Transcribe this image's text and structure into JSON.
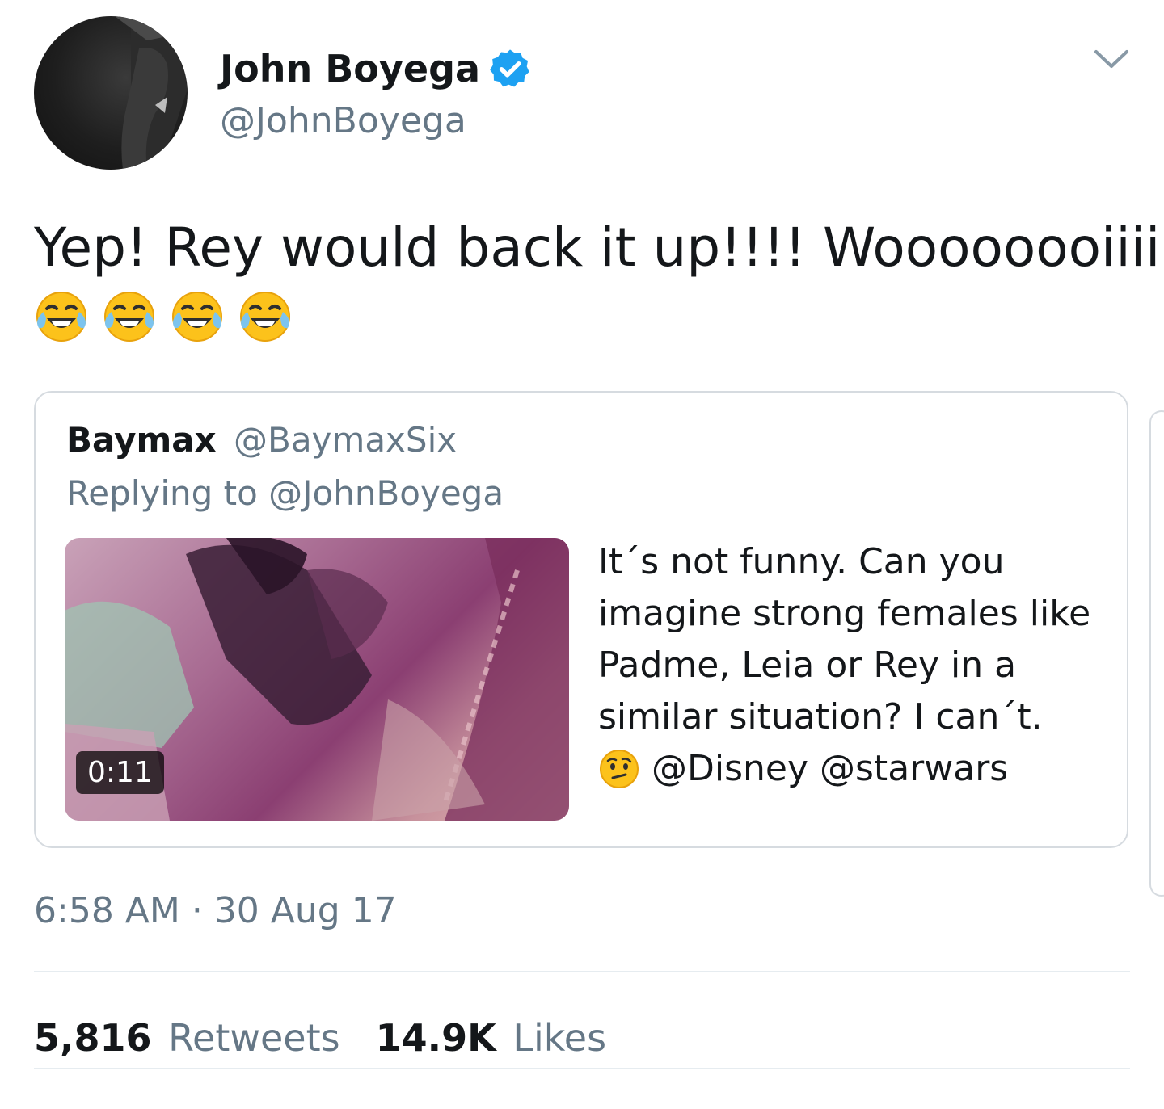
{
  "author": {
    "name": "John Boyega",
    "handle": "@JohnBoyega",
    "verified_icon": "verified-badge-icon",
    "menu_icon": "chevron-down-icon"
  },
  "tweet": {
    "text": "Yep! Rey would back it up!!!! Woooooooiiiiiii",
    "emoji": [
      "face-with-tears-of-joy",
      "face-with-tears-of-joy",
      "face-with-tears-of-joy",
      "face-with-tears-of-joy"
    ]
  },
  "quoted_tweet": {
    "name": "Baymax",
    "handle": "@BaymaxSix",
    "replying_prefix": "Replying to",
    "replying_to": "@JohnBoyega",
    "video_duration": "0:11",
    "text_lines": [
      "It´s not funny. Can you",
      "imagine strong females like",
      "Padme, Leia or Rey in a",
      "similar situation? I can´t."
    ],
    "last_line_emoji": "confused-face",
    "mentions": "@Disney @starwars"
  },
  "timestamp": "6:58 AM · 30 Aug 17",
  "stats": {
    "retweets_count": "5,816",
    "retweets_label": "Retweets",
    "likes_count": "14.9K",
    "likes_label": "Likes"
  },
  "colors": {
    "text": "#14171a",
    "secondary": "#657786",
    "verified": "#1da1f2",
    "border": "#d6dbe0"
  }
}
